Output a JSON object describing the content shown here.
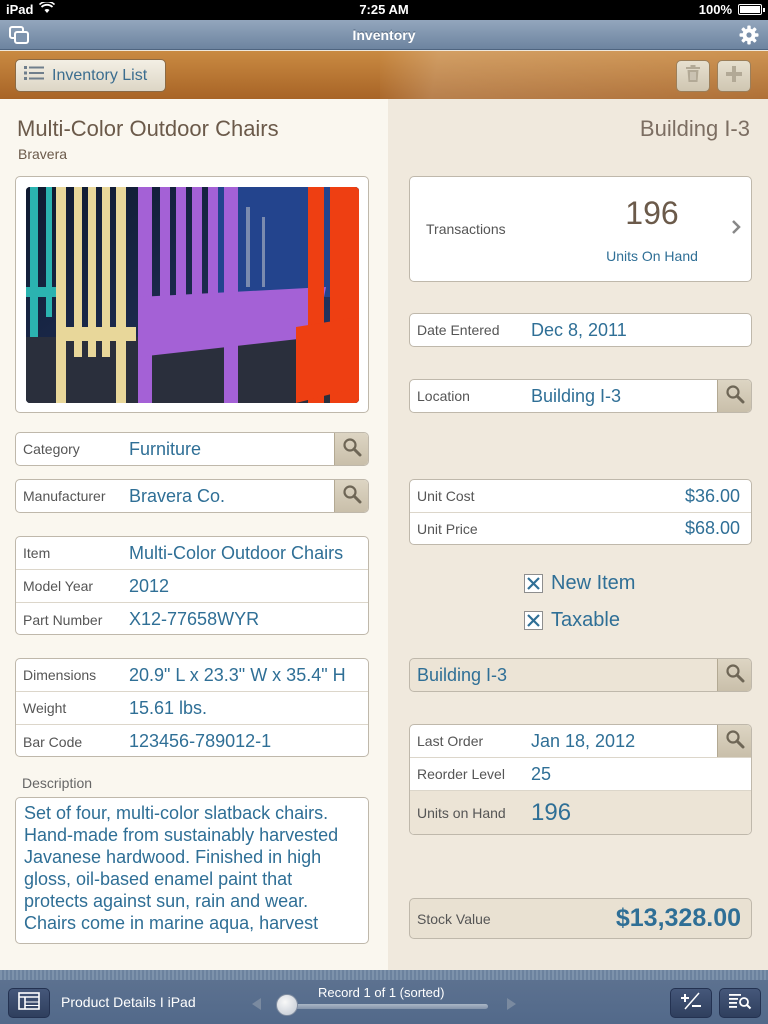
{
  "status_bar": {
    "device": "iPad",
    "time": "7:25 AM",
    "battery": "100%"
  },
  "title_bar": {
    "title": "Inventory"
  },
  "toolbar": {
    "inventory_list_label": "Inventory List"
  },
  "header": {
    "item_name": "Multi-Color Outdoor Chairs",
    "manufacturer_short": "Bravera",
    "location_heading": "Building I-3"
  },
  "fields_left": {
    "category": {
      "label": "Category",
      "value": "Furniture"
    },
    "manufacturer": {
      "label": "Manufacturer",
      "value": "Bravera Co."
    },
    "item": {
      "label": "Item",
      "value": "Multi-Color Outdoor Chairs"
    },
    "model_year": {
      "label": "Model Year",
      "value": "2012"
    },
    "part_number": {
      "label": "Part Number",
      "value": "X12-77658WYR"
    },
    "dimensions": {
      "label": "Dimensions",
      "value": "20.9\" L x 23.3\" W x 35.4\" H"
    },
    "weight": {
      "label": "Weight",
      "value": "15.61 lbs."
    },
    "bar_code": {
      "label": "Bar Code",
      "value": "123456-789012-1"
    }
  },
  "description": {
    "label": "Description",
    "text": "Set of four, multi-color slatback chairs. Hand-made from sustainably harvested Javanese hardwood. Finished in high gloss, oil-based enamel paint that protects against sun, rain and wear. Chairs come in marine aqua, harvest"
  },
  "transactions": {
    "label": "Transactions",
    "count": "196",
    "sub_label": "Units On Hand"
  },
  "fields_right": {
    "date_entered": {
      "label": "Date Entered",
      "value": "Dec 8, 2011"
    },
    "location": {
      "label": "Location",
      "value": "Building I-3"
    },
    "unit_cost": {
      "label": "Unit Cost",
      "value": "$36.00"
    },
    "unit_price": {
      "label": "Unit Price",
      "value": "$68.00"
    },
    "location_field": {
      "value": "Building I-3"
    },
    "last_order": {
      "label": "Last Order",
      "value": "Jan 18, 2012"
    },
    "reorder_level": {
      "label": "Reorder Level",
      "value": "25"
    },
    "units_on_hand": {
      "label": "Units on Hand",
      "value": "196"
    },
    "stock_value": {
      "label": "Stock Value",
      "value": "$13,328.00"
    }
  },
  "checkboxes": {
    "new_item": {
      "label": "New Item",
      "checked": true
    },
    "taxable": {
      "label": "Taxable",
      "checked": true
    }
  },
  "bottom_bar": {
    "layout_name": "Product Details I iPad",
    "record_status": "Record 1 of 1 (sorted)"
  },
  "colors": {
    "accent_text": "#2f6f96",
    "toolbar_orange": "#b8763a",
    "titlebar_blue": "#7b90aa"
  }
}
